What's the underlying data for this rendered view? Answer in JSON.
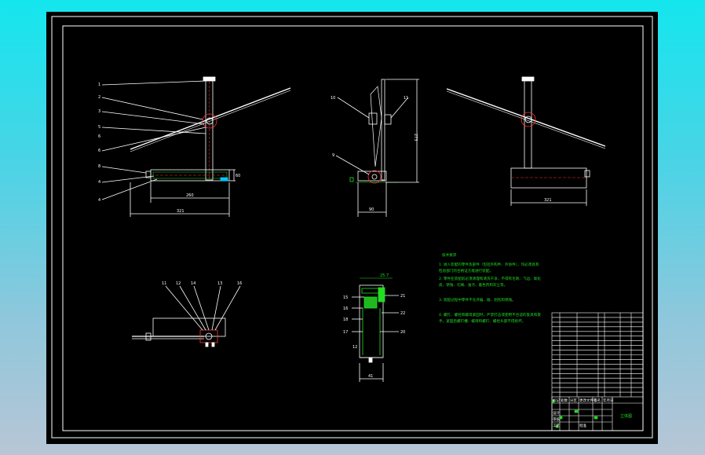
{
  "drawing": {
    "background": "#000000",
    "line_color": "#ffffff",
    "accent_green": "#22dd22",
    "accent_cyan": "#00c8ff",
    "accent_red": "#ff3333"
  },
  "front_view": {
    "callouts": [
      "1",
      "2",
      "3",
      "5",
      "6",
      "6",
      "8",
      "4",
      "4"
    ],
    "dim_inner": "260",
    "dim_outer": "321",
    "dim_height": "60"
  },
  "side_view": {
    "callouts": [
      "10",
      "11",
      "9"
    ],
    "dim_height": "273",
    "dim_width": "90"
  },
  "rear_view": {
    "dim_width": "321"
  },
  "detail_a": {
    "callouts": [
      "11",
      "12",
      "14",
      "13",
      "16"
    ]
  },
  "section_b": {
    "callouts_left": [
      "15",
      "16",
      "18",
      "17"
    ],
    "callouts_right": [
      "21",
      "22",
      "20"
    ],
    "dim_top": "25.7",
    "dim_bottom": "41",
    "dim_left": "12"
  },
  "tech_notes": {
    "title": "技术要求",
    "lines": [
      "1. 进入装配的零件及部件（包括外购件、外协件），均必须具有",
      "检验部门的合格证方能进行装配。",
      "2. 零件在装配前必须清理和清洗干净，不得有毛刺、飞边、氧化",
      "皮、锈蚀、切屑、油污、着色剂和灰尘等。",
      "3. 装配过程中零件不允许磕、碰、划伤和锈蚀。",
      "4. 螺钉、螺栓和螺母紧固时，严禁打击或使用不合适的旋具和扳",
      "手。紧固后螺钉槽、螺母和螺钉、螺栓头部不得损坏。"
    ]
  },
  "title_block": {
    "drawing_name": "立体图",
    "row_labels": [
      "标记",
      "处数",
      "分区",
      "更改文件号",
      "签名",
      "年月日"
    ],
    "role_labels": [
      "设计",
      "审核",
      "工艺",
      "批准"
    ],
    "bom_rows": 18
  }
}
